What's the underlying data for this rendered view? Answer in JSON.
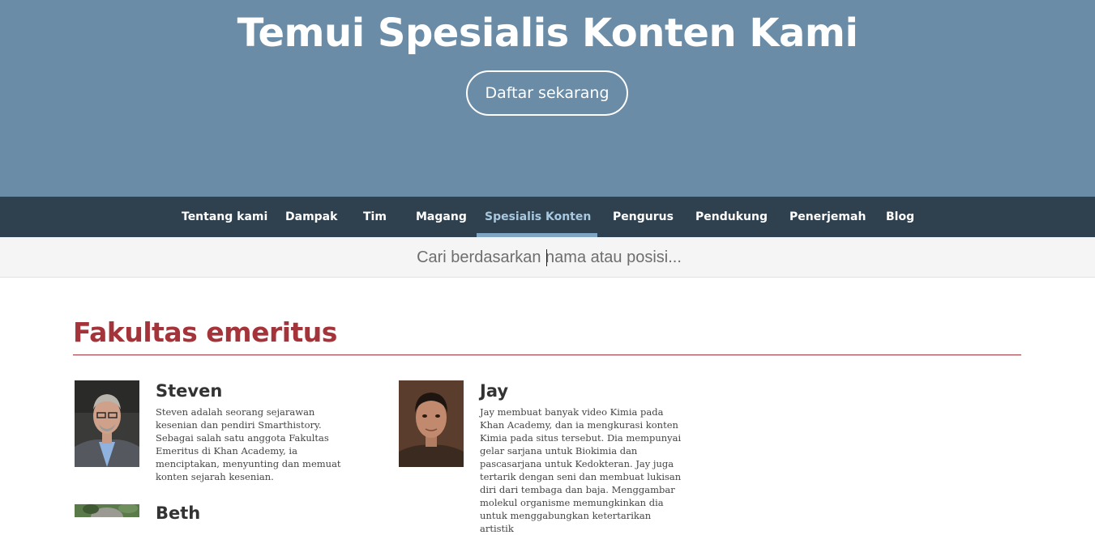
{
  "hero": {
    "title": "Temui Spesialis Konten Kami",
    "cta_label": "Daftar sekarang"
  },
  "nav": {
    "items": [
      {
        "label": "Tentang kami"
      },
      {
        "label": "Dampak"
      },
      {
        "label": "Tim"
      },
      {
        "label": "Magang"
      },
      {
        "label": "Spesialis Konten",
        "active": true
      },
      {
        "label": "Pengurus"
      },
      {
        "label": "Pendukung"
      },
      {
        "label": "Penerjemah"
      },
      {
        "label": "Blog"
      }
    ]
  },
  "search": {
    "placeholder": "Cari berdasarkan nama atau posisi..."
  },
  "section": {
    "title": "Fakultas emeritus"
  },
  "people": [
    {
      "name": "Steven",
      "bio": "Steven adalah seorang sejarawan kesenian dan pendiri Smarthistory. Sebagai salah satu anggota Fakultas Emeritus di Khan Academy, ia menciptakan, menyunting dan memuat konten sejarah kesenian."
    },
    {
      "name": "Jay",
      "bio": "Jay membuat banyak video Kimia pada Khan Academy, dan ia mengkurasi konten Kimia pada situs tersebut. Dia mempunyai gelar sarjana untuk Biokimia dan pascasarjana untuk Kedokteran. Jay juga tertarik dengan seni dan membuat lukisan diri dari tembaga dan baja. Menggambar molekul organisme memungkinkan dia untuk menggabungkan ketertarikan artistik"
    },
    {
      "name": "Beth"
    }
  ],
  "colors": {
    "hero_bg": "#6a8ca6",
    "nav_bg": "#2f414e",
    "accent": "#a5343a"
  }
}
